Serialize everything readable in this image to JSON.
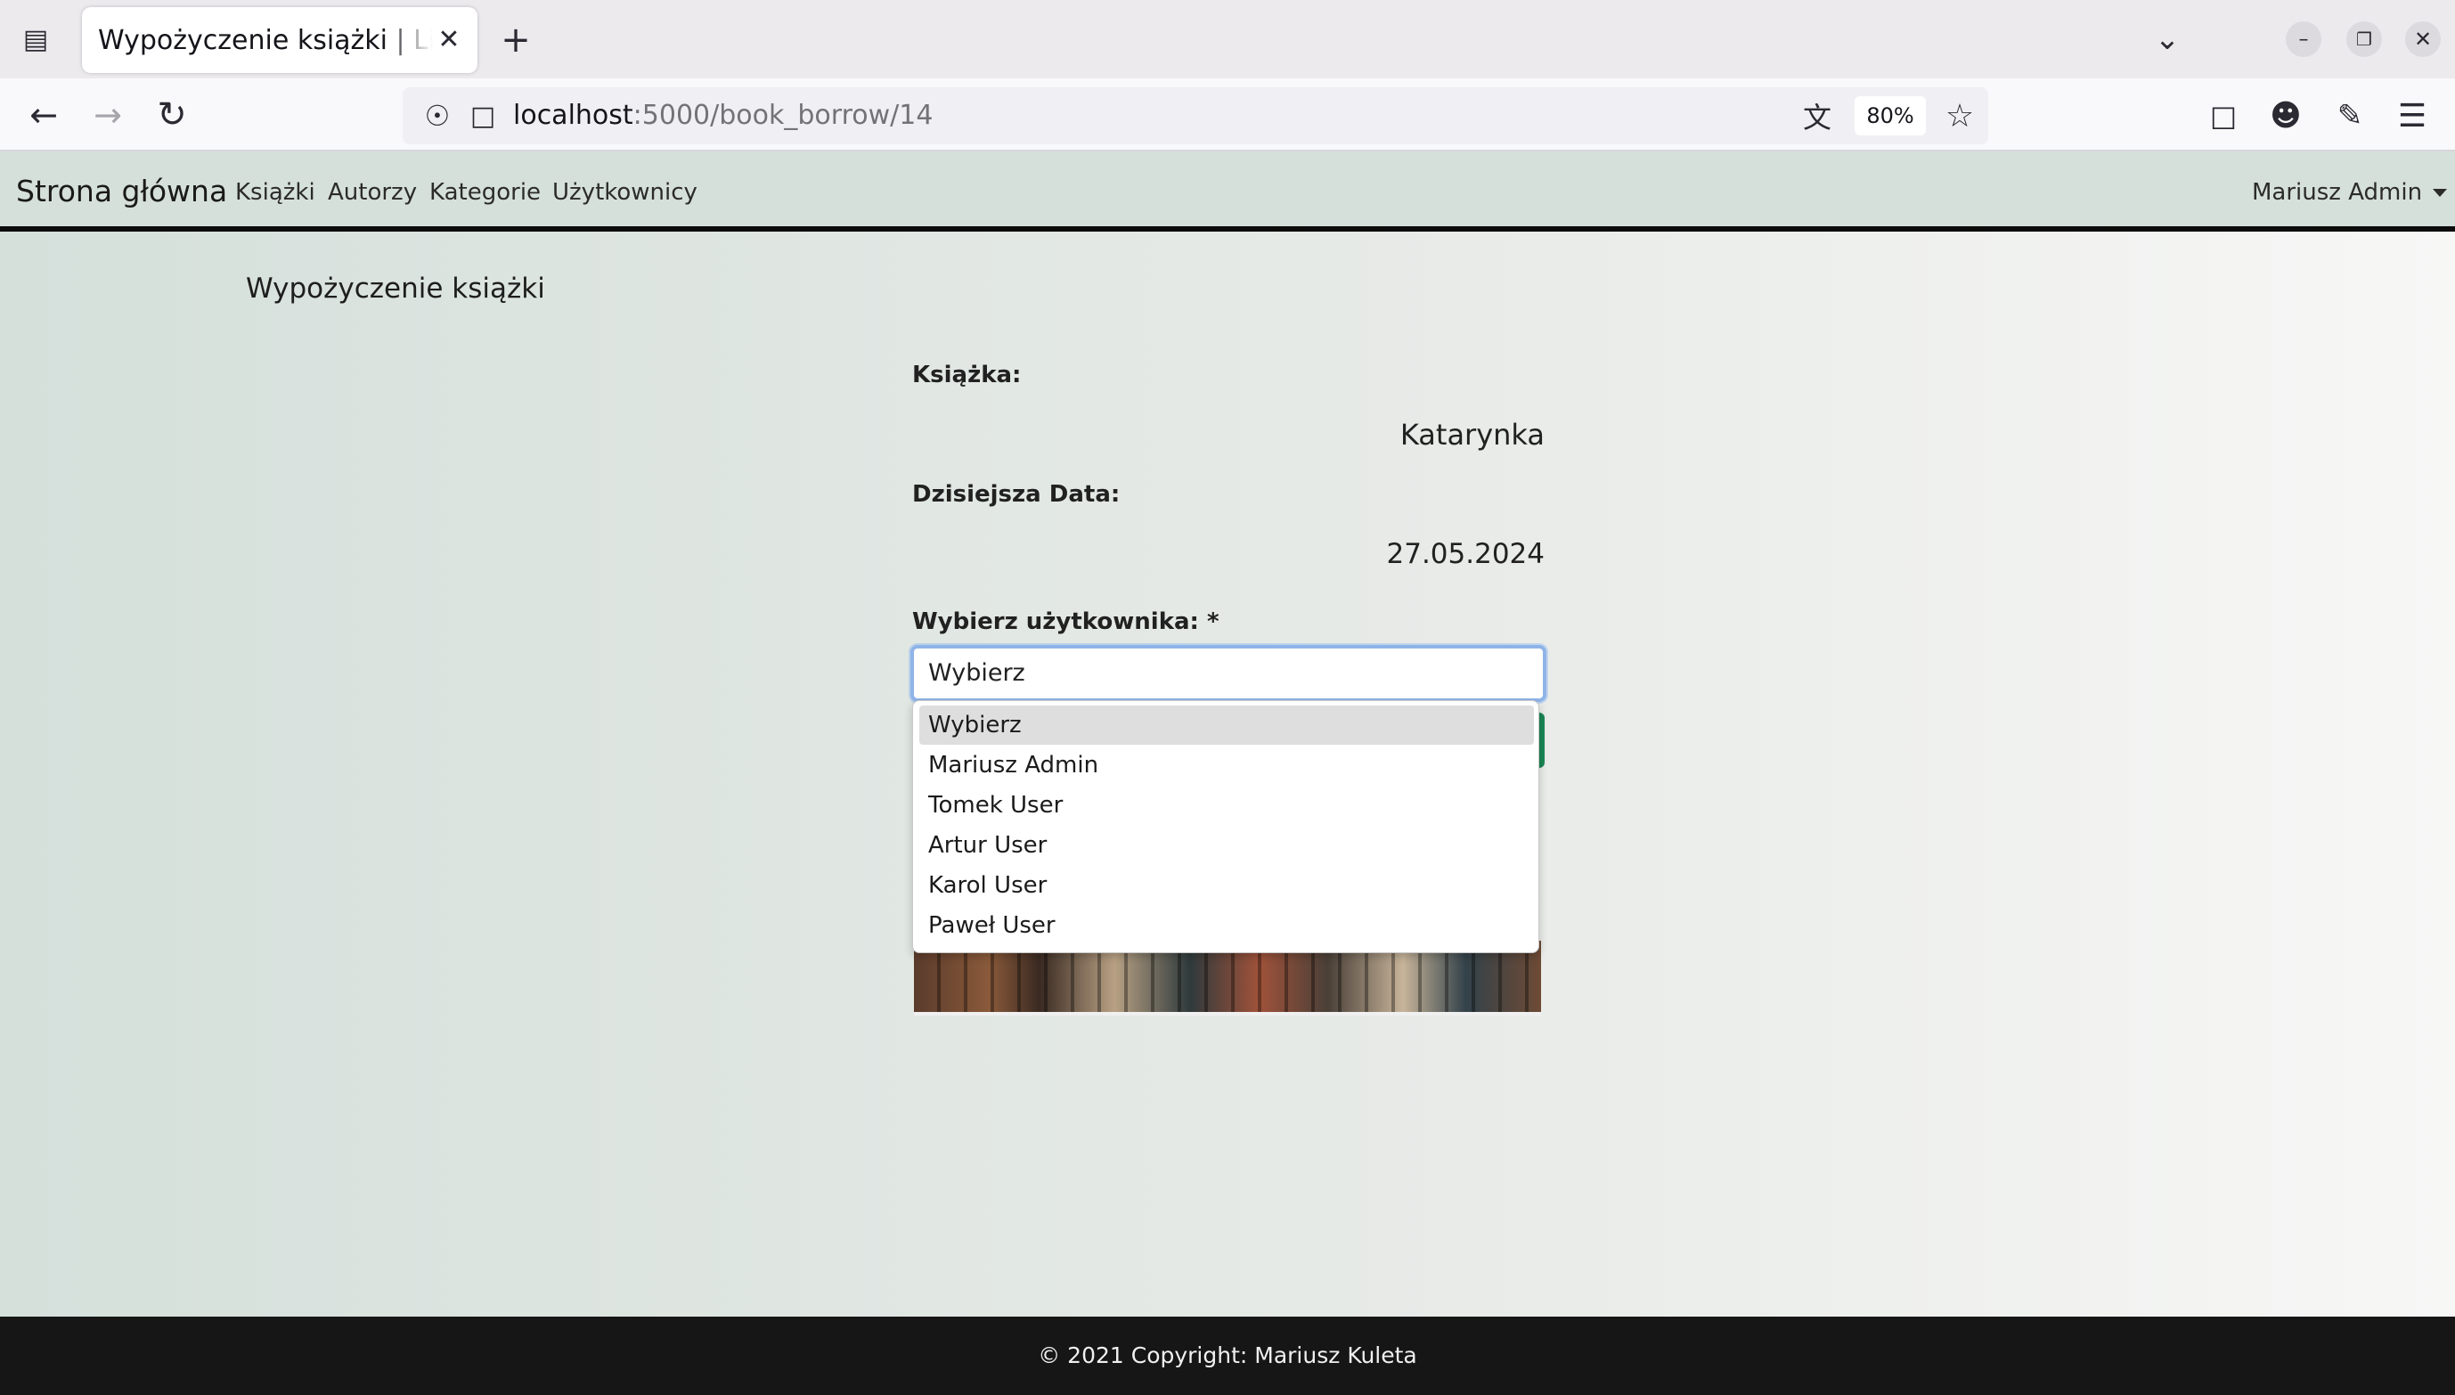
{
  "browser": {
    "tab_title": "Wypożyczenie książki | Library",
    "url_host": "localhost",
    "url_path": ":5000/book_borrow/14",
    "zoom": "80%",
    "icons": {
      "tab_list": "tab-list-icon",
      "close": "close-icon",
      "new_tab": "plus-icon",
      "back": "arrow-left-icon",
      "forward": "arrow-right-icon",
      "reload": "reload-icon",
      "shield": "shield-icon",
      "page": "page-icon",
      "translate": "translate-icon",
      "star": "star-icon",
      "pocket": "pocket-icon",
      "account": "account-icon",
      "extensions": "puzzle-icon",
      "menu": "hamburger-icon"
    }
  },
  "navbar": {
    "brand": "Strona główna",
    "links": [
      "Książki",
      "Autorzy",
      "Kategorie",
      "Użytkownicy"
    ],
    "user": "Mariusz Admin"
  },
  "main": {
    "title": "Wypożyczenie książki",
    "book_label": "Książka:",
    "book_value": "Katarynka",
    "date_label": "Dzisiejsza Data:",
    "date_value": "27.05.2024",
    "user_label": "Wybierz użytkownika: *",
    "select": {
      "value": "Wybierz",
      "options": [
        "Wybierz",
        "Mariusz Admin",
        "Tomek User",
        "Artur User",
        "Karol User",
        "Paweł User"
      ],
      "highlighted_index": 0
    }
  },
  "footer": {
    "text": "© 2021 Copyright: Mariusz Kuleta"
  },
  "colors": {
    "navbar_bg": "#d6e0db",
    "submit_button": "#198754",
    "focus_border": "#8fb4e8",
    "footer_bg": "#161616"
  }
}
